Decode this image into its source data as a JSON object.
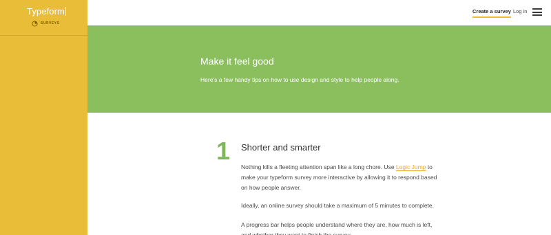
{
  "sidebar": {
    "logo": "Typeform",
    "product_icon": "survey-pie-icon",
    "product_label": "SURVEYS"
  },
  "topbar": {
    "create_label": "Create a survey",
    "login_label": "Log in",
    "menu_icon": "hamburger-menu-icon"
  },
  "hero": {
    "title": "Make it feel good",
    "subtitle": "Here’s a few handy tips on how to use design and style to help people along."
  },
  "tip": {
    "number": "1",
    "title": "Shorter and smarter",
    "p1_before": "Nothing kills a fleeting attention span like a long chore. Use ",
    "p1_link": "Logic Jump",
    "p1_after": " to make your typeform survey more interactive by allowing it to respond based on how people answer.",
    "p2": "Ideally, an online survey should take a maximum of 5 minutes to complete.",
    "p3": "A progress bar helps people understand where they are, how much is left, and whether they want to finish the survey."
  },
  "colors": {
    "sidebar": "#e9bd37",
    "hero": "#8bbf5e",
    "accent_green": "#7fb65a",
    "link": "#e9a92c"
  }
}
